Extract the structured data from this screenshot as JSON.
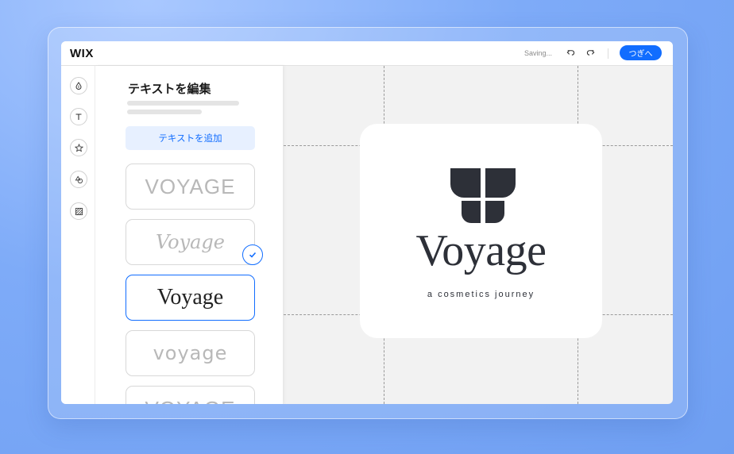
{
  "app": {
    "logo": "WIX",
    "saving_status": "Saving...",
    "next_label": "つぎへ"
  },
  "panel": {
    "title": "テキストを編集",
    "add_text_label": "テキストを追加",
    "options": [
      "VOYAGE",
      "Voyage",
      "Voyage",
      "voyage",
      "VOYAGE"
    ]
  },
  "logo_preview": {
    "name": "Voyage",
    "tagline": "a cosmetics journey"
  },
  "colors": {
    "accent": "#116dff",
    "logo_dark": "#2d3038"
  },
  "icons": [
    "drop-icon",
    "text-icon",
    "star-icon",
    "shapes-icon",
    "pattern-icon"
  ]
}
